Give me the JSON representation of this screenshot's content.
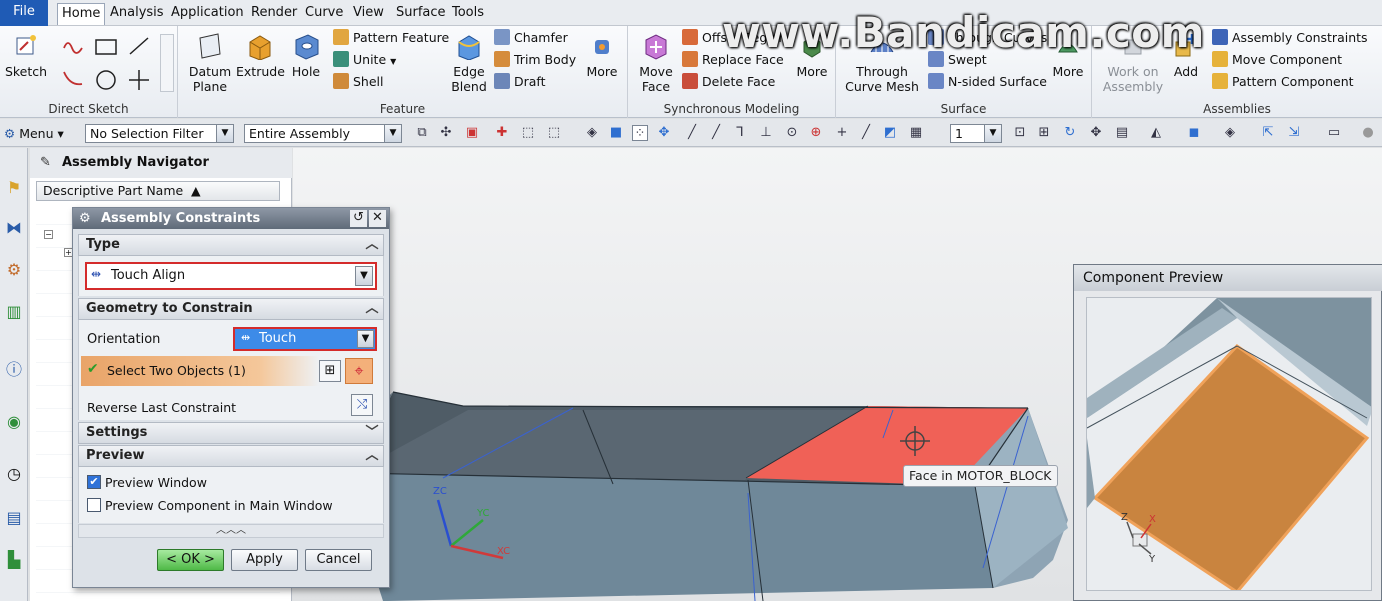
{
  "menubar": {
    "items": [
      "File",
      "Home",
      "Analysis",
      "Application",
      "Render",
      "Curve",
      "View",
      "Surface",
      "Tools"
    ],
    "active": "Home"
  },
  "ribbon": {
    "direct_sketch": {
      "label": "Direct Sketch",
      "sketch": "Sketch"
    },
    "feature": {
      "label": "Feature",
      "datum_plane": "Datum Plane",
      "extrude": "Extrude",
      "hole": "Hole",
      "pattern_feature": "Pattern Feature",
      "unite": "Unite",
      "shell": "Shell",
      "edge_blend": "Edge Blend",
      "chamfer": "Chamfer",
      "trim_body": "Trim Body",
      "draft": "Draft",
      "more": "More"
    },
    "sync": {
      "label": "Synchronous Modeling",
      "move_face": "Move Face",
      "offset_region": "Offset Region",
      "replace_face": "Replace Face",
      "delete_face": "Delete Face",
      "more": "More"
    },
    "surface": {
      "label": "Surface",
      "through_curve_mesh": "Through Curve Mesh",
      "through_curves": "Through Curves",
      "swept": "Swept",
      "n_sided": "N-sided Surface",
      "more": "More"
    },
    "assemblies": {
      "label": "Assemblies",
      "work_on_assembly": "Work on Assembly",
      "add": "Add",
      "assembly_constraints": "Assembly Constraints",
      "move_component": "Move Component",
      "pattern_component": "Pattern Component"
    }
  },
  "toolbar": {
    "menu": "Menu",
    "selection_filter": "No Selection Filter",
    "scope": "Entire Assembly",
    "layer": "1"
  },
  "navigator": {
    "title": "Assembly Navigator",
    "column": "Descriptive Part Name"
  },
  "dialog": {
    "title": "Assembly Constraints",
    "type_section": "Type",
    "type_value": "Touch Align",
    "geometry_section": "Geometry to Constrain",
    "orientation_label": "Orientation",
    "orientation_value": "Touch",
    "select_objects": "Select Two Objects (1)",
    "reverse_last": "Reverse Last Constraint",
    "settings_section": "Settings",
    "preview_section": "Preview",
    "preview_window": "Preview Window",
    "preview_window_checked": true,
    "preview_in_main": "Preview Component in Main Window",
    "preview_in_main_checked": false,
    "ok": "< OK >",
    "apply": "Apply",
    "cancel": "Cancel"
  },
  "viewport": {
    "tooltip": "Face in MOTOR_BLOCK",
    "axis_labels": {
      "z": "ZC",
      "y": "YC",
      "x": "XC"
    }
  },
  "preview_panel": {
    "title": "Component Preview",
    "axis_labels": {
      "z": "Z",
      "y": "Y",
      "x": "X"
    }
  },
  "watermark": "www.Bandicam.com",
  "colors": {
    "selected_face": "#f06157",
    "preview_face": "#c9843f",
    "highlight_orange": "#f0a25a",
    "menu_file_blue": "#1f5bb5"
  }
}
